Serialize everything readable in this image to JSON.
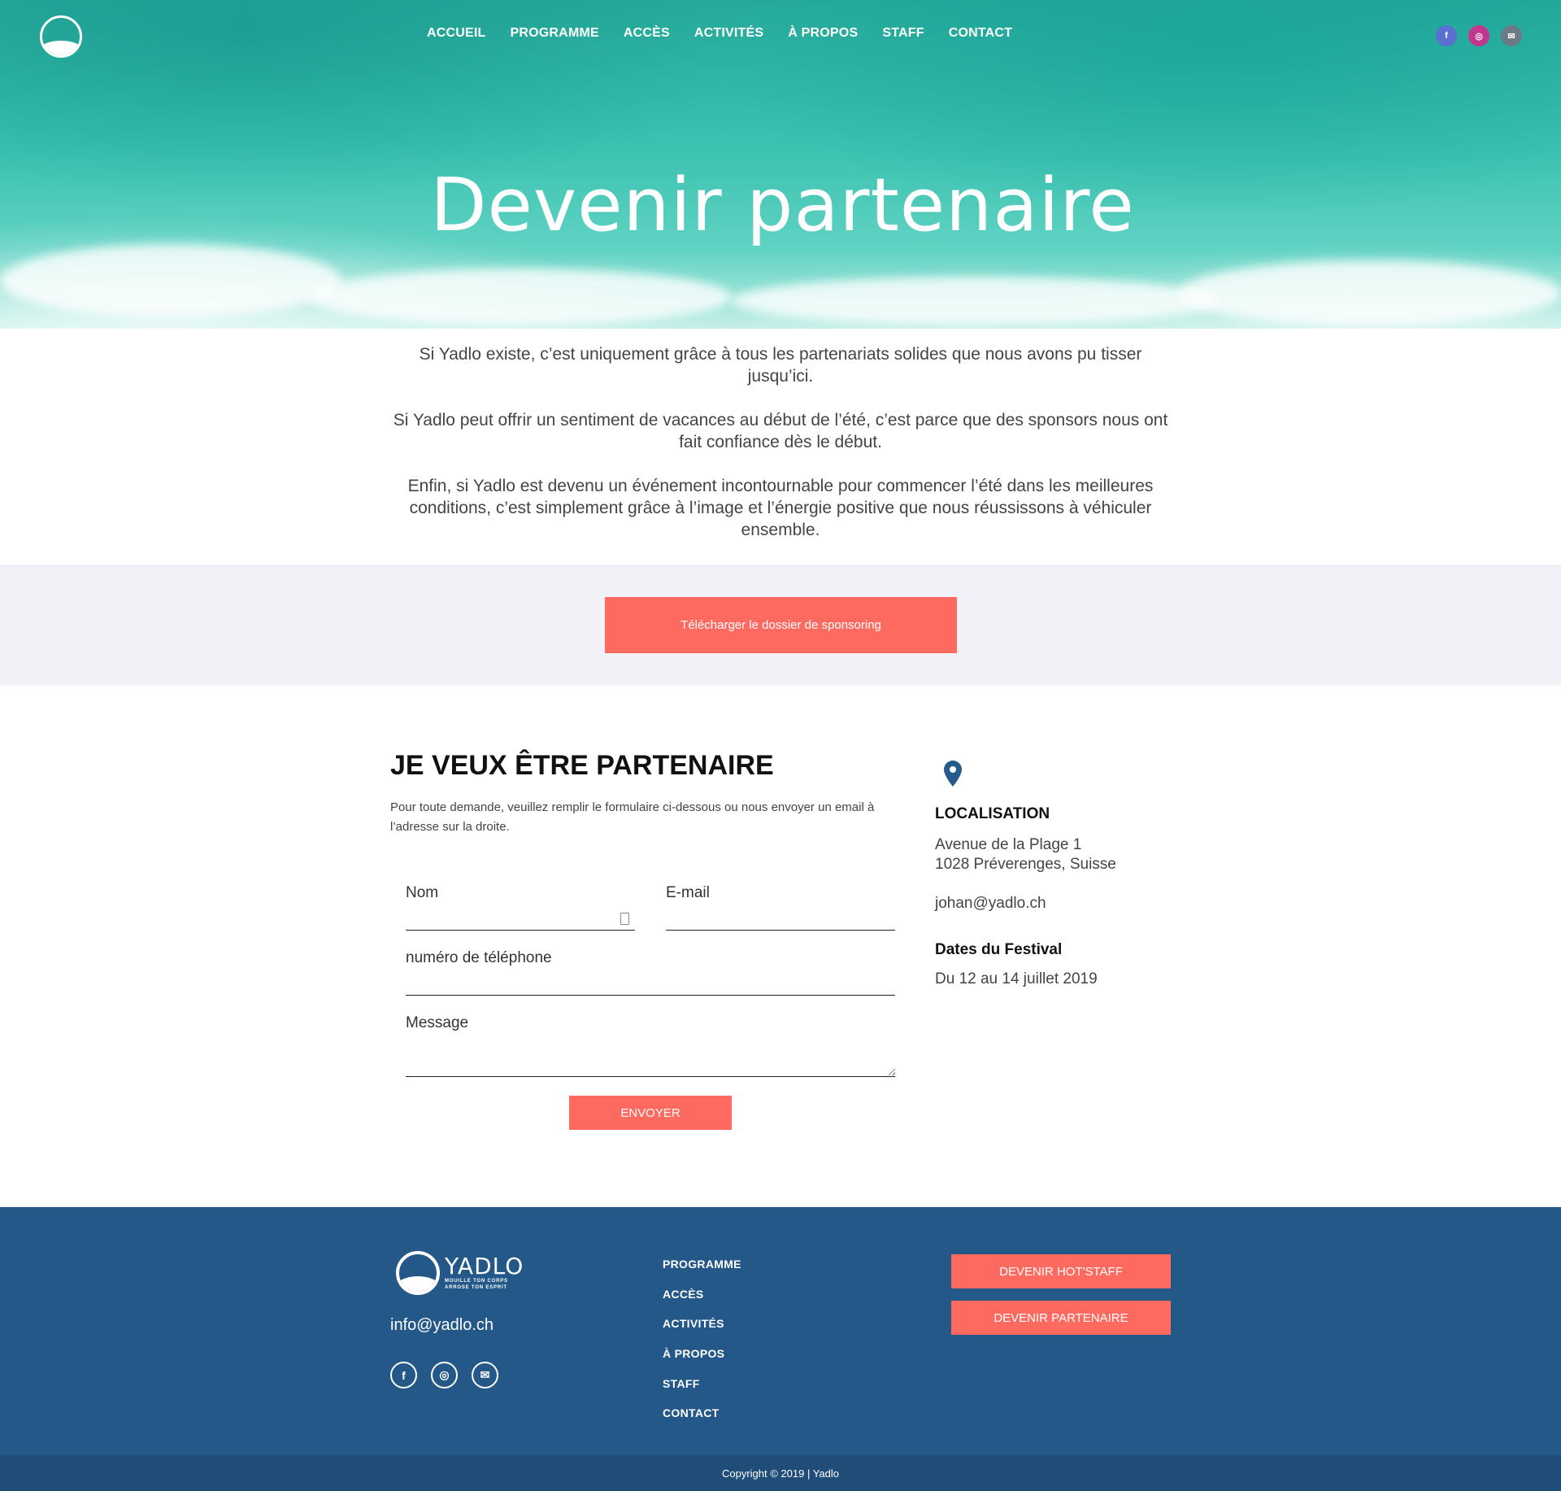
{
  "header": {
    "nav": [
      "ACCUEIL",
      "PROGRAMME",
      "ACCÈS",
      "ACTIVITÉS",
      "À PROPOS",
      "STAFF",
      "CONTACT"
    ],
    "social": [
      {
        "icon": "facebook-icon",
        "glyph": "f",
        "color": "#5b6fd1"
      },
      {
        "icon": "instagram-icon",
        "glyph": "◎",
        "color": "#c2378d"
      },
      {
        "icon": "email-icon",
        "glyph": "✉",
        "color": "#6b7a85"
      }
    ]
  },
  "hero": {
    "title": "Devenir partenaire"
  },
  "intro": {
    "p1": "Si Yadlo existe, c’est uniquement grâce à tous les partenariats solides que nous avons pu tisser jusqu’ici.",
    "p2": "Si Yadlo peut offrir un sentiment de vacances au début de l’été, c’est parce que des sponsors nous ont fait confiance dès le début.",
    "p3": "Enfin, si Yadlo est devenu un événement incontournable pour commencer l’été dans les meilleures conditions, c’est simplement grâce à l’image et l’énergie positive que nous réussissons à véhiculer ensemble."
  },
  "download": {
    "label": "Télécharger le dossier de sponsoring"
  },
  "form": {
    "title": "JE VEUX ÊTRE PARTENAIRE",
    "description": "Pour toute demande, veuillez remplir le formulaire ci-dessous ou nous envoyer un email à l’adresse sur la droite.",
    "name_label": "Nom",
    "email_label": "E-mail",
    "phone_label": "numéro de téléphone",
    "message_label": "Message",
    "submit_label": "ENVOYER"
  },
  "info": {
    "location_title": "LOCALISATION",
    "address_line1": "Avenue de la Plage 1",
    "address_line2": "1028 Préverenges, Suisse",
    "email": "johan@yadlo.ch",
    "dates_title": "Dates du Festival",
    "dates": "Du 12 au 14 juillet 2019"
  },
  "footer": {
    "brand": "YADLO",
    "tagline1": "MOUILLE TON CORPS",
    "tagline2": "ARROSE TON ESPRIT",
    "email": "info@yadlo.ch",
    "menu": [
      "PROGRAMME",
      "ACCÈS",
      "ACTIVITÉS",
      "À PROPOS",
      "STAFF",
      "CONTACT"
    ],
    "btn_staff": "DEVENIR HOT'STAFF",
    "btn_partner": "DEVENIR PARTENAIRE",
    "copyright": "Copyright © 2019 | Yadlo"
  },
  "colors": {
    "accent": "#ff6a60",
    "footer": "#235888",
    "band": "#f2f1f7"
  }
}
